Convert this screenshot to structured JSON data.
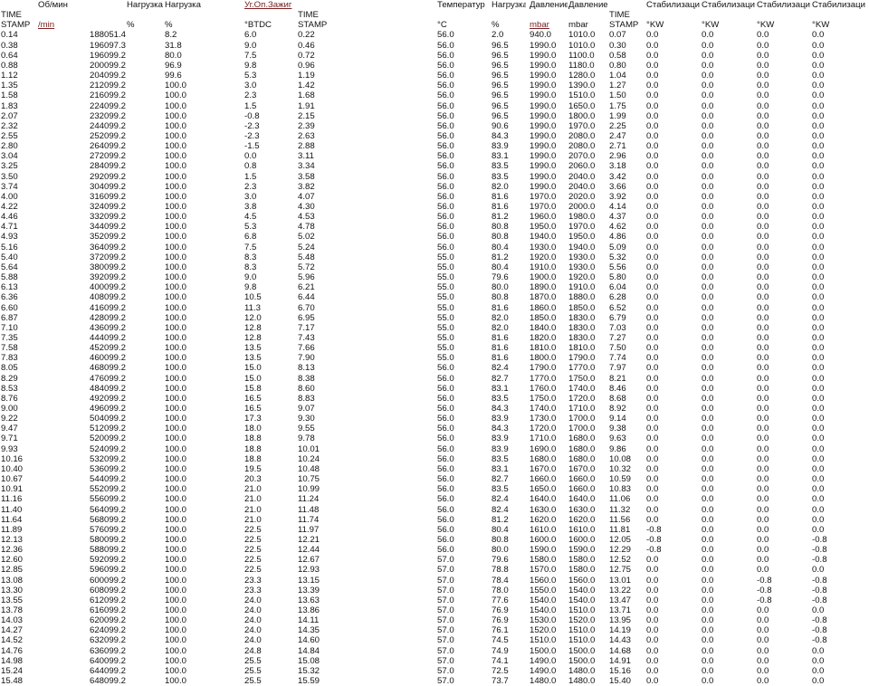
{
  "headers": {
    "row1": [
      "",
      "Об/мин",
      "Нагрузка",
      "Нагрузка",
      "Уг.Оп.Зажиг",
      "",
      "Температур",
      "Нагрузка",
      "Давление",
      "Давление",
      "",
      "Стабилизаци",
      "Стабилизаци",
      "Стабилизаци",
      "Стабилизаци"
    ],
    "row2": [
      "TIME",
      "",
      "",
      "",
      "",
      "TIME",
      "",
      "",
      "",
      "",
      "TIME",
      "",
      "",
      "",
      ""
    ],
    "row3": [
      "STAMP",
      "/min",
      "%",
      "%",
      "°BTDC",
      "STAMP",
      "°C",
      "%",
      "mbar",
      "mbar",
      "STAMP",
      "°KW",
      "°KW",
      "°KW",
      "°KW"
    ]
  },
  "rows": [
    [
      "0.14",
      "1880",
      "51.4",
      "8.2",
      "6.0",
      "0.22",
      "56.0",
      "2.0",
      "940.0",
      "1010.0",
      "0.07",
      "0.0",
      "0.0",
      "0.0",
      "0.0"
    ],
    [
      "0.38",
      "1960",
      "97.3",
      "31.8",
      "9.0",
      "0.46",
      "56.0",
      "96.5",
      "1990.0",
      "1010.0",
      "0.30",
      "0.0",
      "0.0",
      "0.0",
      "0.0"
    ],
    [
      "0.64",
      "1960",
      "99.2",
      "80.0",
      "7.5",
      "0.72",
      "56.0",
      "96.5",
      "1990.0",
      "1100.0",
      "0.58",
      "0.0",
      "0.0",
      "0.0",
      "0.0"
    ],
    [
      "0.88",
      "2000",
      "99.2",
      "96.9",
      "9.8",
      "0.96",
      "56.0",
      "96.5",
      "1990.0",
      "1180.0",
      "0.80",
      "0.0",
      "0.0",
      "0.0",
      "0.0"
    ],
    [
      "1.12",
      "2040",
      "99.2",
      "99.6",
      "5.3",
      "1.19",
      "56.0",
      "96.5",
      "1990.0",
      "1280.0",
      "1.04",
      "0.0",
      "0.0",
      "0.0",
      "0.0"
    ],
    [
      "1.35",
      "2120",
      "99.2",
      "100.0",
      "3.0",
      "1.42",
      "56.0",
      "96.5",
      "1990.0",
      "1390.0",
      "1.27",
      "0.0",
      "0.0",
      "0.0",
      "0.0"
    ],
    [
      "1.58",
      "2160",
      "99.2",
      "100.0",
      "2.3",
      "1.68",
      "56.0",
      "96.5",
      "1990.0",
      "1510.0",
      "1.50",
      "0.0",
      "0.0",
      "0.0",
      "0.0"
    ],
    [
      "1.83",
      "2240",
      "99.2",
      "100.0",
      "1.5",
      "1.91",
      "56.0",
      "96.5",
      "1990.0",
      "1650.0",
      "1.75",
      "0.0",
      "0.0",
      "0.0",
      "0.0"
    ],
    [
      "2.07",
      "2320",
      "99.2",
      "100.0",
      "-0.8",
      "2.15",
      "56.0",
      "96.5",
      "1990.0",
      "1800.0",
      "1.99",
      "0.0",
      "0.0",
      "0.0",
      "0.0"
    ],
    [
      "2.32",
      "2440",
      "99.2",
      "100.0",
      "-2.3",
      "2.39",
      "56.0",
      "90.6",
      "1990.0",
      "1970.0",
      "2.25",
      "0.0",
      "0.0",
      "0.0",
      "0.0"
    ],
    [
      "2.55",
      "2520",
      "99.2",
      "100.0",
      "-2.3",
      "2.63",
      "56.0",
      "84.3",
      "1990.0",
      "2080.0",
      "2.47",
      "0.0",
      "0.0",
      "0.0",
      "0.0"
    ],
    [
      "2.80",
      "2640",
      "99.2",
      "100.0",
      "-1.5",
      "2.88",
      "56.0",
      "83.9",
      "1990.0",
      "2080.0",
      "2.71",
      "0.0",
      "0.0",
      "0.0",
      "0.0"
    ],
    [
      "3.04",
      "2720",
      "99.2",
      "100.0",
      "0.0",
      "3.11",
      "56.0",
      "83.1",
      "1990.0",
      "2070.0",
      "2.96",
      "0.0",
      "0.0",
      "0.0",
      "0.0"
    ],
    [
      "3.25",
      "2840",
      "99.2",
      "100.0",
      "0.8",
      "3.34",
      "56.0",
      "83.5",
      "1990.0",
      "2060.0",
      "3.18",
      "0.0",
      "0.0",
      "0.0",
      "0.0"
    ],
    [
      "3.50",
      "2920",
      "99.2",
      "100.0",
      "1.5",
      "3.58",
      "56.0",
      "83.5",
      "1990.0",
      "2040.0",
      "3.42",
      "0.0",
      "0.0",
      "0.0",
      "0.0"
    ],
    [
      "3.74",
      "3040",
      "99.2",
      "100.0",
      "2.3",
      "3.82",
      "56.0",
      "82.0",
      "1990.0",
      "2040.0",
      "3.66",
      "0.0",
      "0.0",
      "0.0",
      "0.0"
    ],
    [
      "4.00",
      "3160",
      "99.2",
      "100.0",
      "3.0",
      "4.07",
      "56.0",
      "81.6",
      "1970.0",
      "2020.0",
      "3.92",
      "0.0",
      "0.0",
      "0.0",
      "0.0"
    ],
    [
      "4.22",
      "3240",
      "99.2",
      "100.0",
      "3.8",
      "4.30",
      "56.0",
      "81.6",
      "1970.0",
      "2000.0",
      "4.14",
      "0.0",
      "0.0",
      "0.0",
      "0.0"
    ],
    [
      "4.46",
      "3320",
      "99.2",
      "100.0",
      "4.5",
      "4.53",
      "56.0",
      "81.2",
      "1960.0",
      "1980.0",
      "4.37",
      "0.0",
      "0.0",
      "0.0",
      "0.0"
    ],
    [
      "4.71",
      "3440",
      "99.2",
      "100.0",
      "5.3",
      "4.78",
      "56.0",
      "80.8",
      "1950.0",
      "1970.0",
      "4.62",
      "0.0",
      "0.0",
      "0.0",
      "0.0"
    ],
    [
      "4.93",
      "3520",
      "99.2",
      "100.0",
      "6.8",
      "5.02",
      "56.0",
      "80.8",
      "1940.0",
      "1950.0",
      "4.86",
      "0.0",
      "0.0",
      "0.0",
      "0.0"
    ],
    [
      "5.16",
      "3640",
      "99.2",
      "100.0",
      "7.5",
      "5.24",
      "56.0",
      "80.4",
      "1930.0",
      "1940.0",
      "5.09",
      "0.0",
      "0.0",
      "0.0",
      "0.0"
    ],
    [
      "5.40",
      "3720",
      "99.2",
      "100.0",
      "8.3",
      "5.48",
      "55.0",
      "81.2",
      "1920.0",
      "1930.0",
      "5.32",
      "0.0",
      "0.0",
      "0.0",
      "0.0"
    ],
    [
      "5.64",
      "3800",
      "99.2",
      "100.0",
      "8.3",
      "5.72",
      "55.0",
      "80.4",
      "1910.0",
      "1930.0",
      "5.56",
      "0.0",
      "0.0",
      "0.0",
      "0.0"
    ],
    [
      "5.88",
      "3920",
      "99.2",
      "100.0",
      "9.0",
      "5.96",
      "55.0",
      "79.6",
      "1900.0",
      "1920.0",
      "5.80",
      "0.0",
      "0.0",
      "0.0",
      "0.0"
    ],
    [
      "6.13",
      "4000",
      "99.2",
      "100.0",
      "9.8",
      "6.21",
      "55.0",
      "80.0",
      "1890.0",
      "1910.0",
      "6.04",
      "0.0",
      "0.0",
      "0.0",
      "0.0"
    ],
    [
      "6.36",
      "4080",
      "99.2",
      "100.0",
      "10.5",
      "6.44",
      "55.0",
      "80.8",
      "1870.0",
      "1880.0",
      "6.28",
      "0.0",
      "0.0",
      "0.0",
      "0.0"
    ],
    [
      "6.60",
      "4160",
      "99.2",
      "100.0",
      "11.3",
      "6.70",
      "55.0",
      "81.6",
      "1860.0",
      "1850.0",
      "6.52",
      "0.0",
      "0.0",
      "0.0",
      "0.0"
    ],
    [
      "6.87",
      "4280",
      "99.2",
      "100.0",
      "12.0",
      "6.95",
      "55.0",
      "82.0",
      "1850.0",
      "1830.0",
      "6.79",
      "0.0",
      "0.0",
      "0.0",
      "0.0"
    ],
    [
      "7.10",
      "4360",
      "99.2",
      "100.0",
      "12.8",
      "7.17",
      "55.0",
      "82.0",
      "1840.0",
      "1830.0",
      "7.03",
      "0.0",
      "0.0",
      "0.0",
      "0.0"
    ],
    [
      "7.35",
      "4440",
      "99.2",
      "100.0",
      "12.8",
      "7.43",
      "55.0",
      "81.6",
      "1820.0",
      "1830.0",
      "7.27",
      "0.0",
      "0.0",
      "0.0",
      "0.0"
    ],
    [
      "7.58",
      "4520",
      "99.2",
      "100.0",
      "13.5",
      "7.66",
      "55.0",
      "81.6",
      "1810.0",
      "1810.0",
      "7.50",
      "0.0",
      "0.0",
      "0.0",
      "0.0"
    ],
    [
      "7.83",
      "4600",
      "99.2",
      "100.0",
      "13.5",
      "7.90",
      "55.0",
      "81.6",
      "1800.0",
      "1790.0",
      "7.74",
      "0.0",
      "0.0",
      "0.0",
      "0.0"
    ],
    [
      "8.05",
      "4680",
      "99.2",
      "100.0",
      "15.0",
      "8.13",
      "56.0",
      "82.4",
      "1790.0",
      "1770.0",
      "7.97",
      "0.0",
      "0.0",
      "0.0",
      "0.0"
    ],
    [
      "8.29",
      "4760",
      "99.2",
      "100.0",
      "15.0",
      "8.38",
      "56.0",
      "82.7",
      "1770.0",
      "1750.0",
      "8.21",
      "0.0",
      "0.0",
      "0.0",
      "0.0"
    ],
    [
      "8.53",
      "4840",
      "99.2",
      "100.0",
      "15.8",
      "8.60",
      "56.0",
      "83.1",
      "1760.0",
      "1740.0",
      "8.46",
      "0.0",
      "0.0",
      "0.0",
      "0.0"
    ],
    [
      "8.76",
      "4920",
      "99.2",
      "100.0",
      "16.5",
      "8.83",
      "56.0",
      "83.5",
      "1750.0",
      "1720.0",
      "8.68",
      "0.0",
      "0.0",
      "0.0",
      "0.0"
    ],
    [
      "9.00",
      "4960",
      "99.2",
      "100.0",
      "16.5",
      "9.07",
      "56.0",
      "84.3",
      "1740.0",
      "1710.0",
      "8.92",
      "0.0",
      "0.0",
      "0.0",
      "0.0"
    ],
    [
      "9.22",
      "5040",
      "99.2",
      "100.0",
      "17.3",
      "9.30",
      "56.0",
      "83.9",
      "1730.0",
      "1700.0",
      "9.14",
      "0.0",
      "0.0",
      "0.0",
      "0.0"
    ],
    [
      "9.47",
      "5120",
      "99.2",
      "100.0",
      "18.0",
      "9.55",
      "56.0",
      "84.3",
      "1720.0",
      "1700.0",
      "9.38",
      "0.0",
      "0.0",
      "0.0",
      "0.0"
    ],
    [
      "9.71",
      "5200",
      "99.2",
      "100.0",
      "18.8",
      "9.78",
      "56.0",
      "83.9",
      "1710.0",
      "1680.0",
      "9.63",
      "0.0",
      "0.0",
      "0.0",
      "0.0"
    ],
    [
      "9.93",
      "5240",
      "99.2",
      "100.0",
      "18.8",
      "10.01",
      "56.0",
      "83.9",
      "1690.0",
      "1680.0",
      "9.86",
      "0.0",
      "0.0",
      "0.0",
      "0.0"
    ],
    [
      "10.16",
      "5320",
      "99.2",
      "100.0",
      "18.8",
      "10.24",
      "56.0",
      "83.5",
      "1680.0",
      "1680.0",
      "10.08",
      "0.0",
      "0.0",
      "0.0",
      "0.0"
    ],
    [
      "10.40",
      "5360",
      "99.2",
      "100.0",
      "19.5",
      "10.48",
      "56.0",
      "83.1",
      "1670.0",
      "1670.0",
      "10.32",
      "0.0",
      "0.0",
      "0.0",
      "0.0"
    ],
    [
      "10.67",
      "5440",
      "99.2",
      "100.0",
      "20.3",
      "10.75",
      "56.0",
      "82.7",
      "1660.0",
      "1660.0",
      "10.59",
      "0.0",
      "0.0",
      "0.0",
      "0.0"
    ],
    [
      "10.91",
      "5520",
      "99.2",
      "100.0",
      "21.0",
      "10.99",
      "56.0",
      "83.5",
      "1650.0",
      "1660.0",
      "10.83",
      "0.0",
      "0.0",
      "0.0",
      "0.0"
    ],
    [
      "11.16",
      "5560",
      "99.2",
      "100.0",
      "21.0",
      "11.24",
      "56.0",
      "82.4",
      "1640.0",
      "1640.0",
      "11.06",
      "0.0",
      "0.0",
      "0.0",
      "0.0"
    ],
    [
      "11.40",
      "5640",
      "99.2",
      "100.0",
      "21.0",
      "11.48",
      "56.0",
      "82.4",
      "1630.0",
      "1630.0",
      "11.32",
      "0.0",
      "0.0",
      "0.0",
      "0.0"
    ],
    [
      "11.64",
      "5680",
      "99.2",
      "100.0",
      "21.0",
      "11.74",
      "56.0",
      "81.2",
      "1620.0",
      "1620.0",
      "11.56",
      "0.0",
      "0.0",
      "0.0",
      "0.0"
    ],
    [
      "11.89",
      "5760",
      "99.2",
      "100.0",
      "22.5",
      "11.97",
      "56.0",
      "80.4",
      "1610.0",
      "1610.0",
      "11.81",
      "-0.8",
      "0.0",
      "0.0",
      "0.0"
    ],
    [
      "12.13",
      "5800",
      "99.2",
      "100.0",
      "22.5",
      "12.21",
      "56.0",
      "80.8",
      "1600.0",
      "1600.0",
      "12.05",
      "-0.8",
      "0.0",
      "0.0",
      "-0.8"
    ],
    [
      "12.36",
      "5880",
      "99.2",
      "100.0",
      "22.5",
      "12.44",
      "56.0",
      "80.0",
      "1590.0",
      "1590.0",
      "12.29",
      "-0.8",
      "0.0",
      "0.0",
      "-0.8"
    ],
    [
      "12.60",
      "5920",
      "99.2",
      "100.0",
      "22.5",
      "12.67",
      "57.0",
      "79.6",
      "1580.0",
      "1580.0",
      "12.52",
      "0.0",
      "0.0",
      "0.0",
      "-0.8"
    ],
    [
      "12.85",
      "5960",
      "99.2",
      "100.0",
      "22.5",
      "12.93",
      "57.0",
      "78.8",
      "1570.0",
      "1580.0",
      "12.75",
      "0.0",
      "0.0",
      "0.0",
      "0.0"
    ],
    [
      "13.08",
      "6000",
      "99.2",
      "100.0",
      "23.3",
      "13.15",
      "57.0",
      "78.4",
      "1560.0",
      "1560.0",
      "13.01",
      "0.0",
      "0.0",
      "-0.8",
      "-0.8"
    ],
    [
      "13.30",
      "6080",
      "99.2",
      "100.0",
      "23.3",
      "13.39",
      "57.0",
      "78.0",
      "1550.0",
      "1540.0",
      "13.22",
      "0.0",
      "0.0",
      "-0.8",
      "-0.8"
    ],
    [
      "13.55",
      "6120",
      "99.2",
      "100.0",
      "24.0",
      "13.63",
      "57.0",
      "77.6",
      "1540.0",
      "1540.0",
      "13.47",
      "0.0",
      "0.0",
      "-0.8",
      "-0.8"
    ],
    [
      "13.78",
      "6160",
      "99.2",
      "100.0",
      "24.0",
      "13.86",
      "57.0",
      "76.9",
      "1540.0",
      "1510.0",
      "13.71",
      "0.0",
      "0.0",
      "0.0",
      "0.0"
    ],
    [
      "14.03",
      "6200",
      "99.2",
      "100.0",
      "24.0",
      "14.11",
      "57.0",
      "76.9",
      "1530.0",
      "1520.0",
      "13.95",
      "0.0",
      "0.0",
      "0.0",
      "-0.8"
    ],
    [
      "14.27",
      "6240",
      "99.2",
      "100.0",
      "24.0",
      "14.35",
      "57.0",
      "76.1",
      "1520.0",
      "1510.0",
      "14.19",
      "0.0",
      "0.0",
      "0.0",
      "-0.8"
    ],
    [
      "14.52",
      "6320",
      "99.2",
      "100.0",
      "24.0",
      "14.60",
      "57.0",
      "74.5",
      "1510.0",
      "1510.0",
      "14.43",
      "0.0",
      "0.0",
      "0.0",
      "-0.8"
    ],
    [
      "14.76",
      "6360",
      "99.2",
      "100.0",
      "24.8",
      "14.84",
      "57.0",
      "74.9",
      "1500.0",
      "1500.0",
      "14.68",
      "0.0",
      "0.0",
      "0.0",
      "0.0"
    ],
    [
      "14.98",
      "6400",
      "99.2",
      "100.0",
      "25.5",
      "15.08",
      "57.0",
      "74.1",
      "1490.0",
      "1500.0",
      "14.91",
      "0.0",
      "0.0",
      "0.0",
      "0.0"
    ],
    [
      "15.24",
      "6440",
      "99.2",
      "100.0",
      "25.5",
      "15.32",
      "57.0",
      "72.5",
      "1490.0",
      "1480.0",
      "15.16",
      "0.0",
      "0.0",
      "0.0",
      "0.0"
    ],
    [
      "15.48",
      "6480",
      "99.2",
      "100.0",
      "25.5",
      "15.59",
      "57.0",
      "73.7",
      "1480.0",
      "1480.0",
      "15.40",
      "0.0",
      "0.0",
      "0.0",
      "0.0"
    ]
  ]
}
